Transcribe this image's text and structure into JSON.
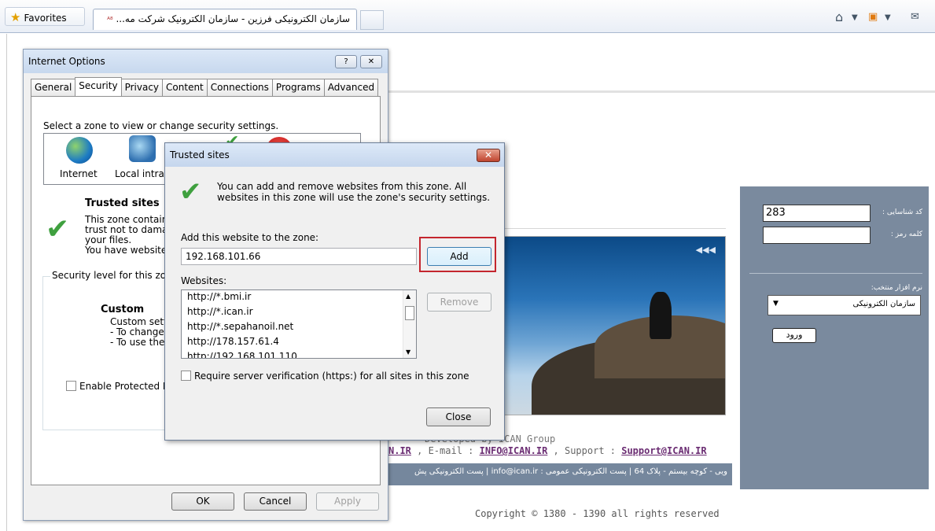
{
  "browser": {
    "favorites_label": "Favorites",
    "tab_title": "سازمان الکترونیکی فرزین - سازمان الکترونیک شرکت مه...",
    "tab_icon_text": "ᴬ⁸"
  },
  "page": {
    "right_panel": {
      "id_label": "کد شناسایی :",
      "id_value": "283",
      "password_label": "کلمه رمز :",
      "software_label": "نرم افزار منتخب:",
      "software_value": "سازمان الکترونیکی",
      "login_button": "ورود"
    },
    "footer": {
      "group_line": "Developed by ICAN Group",
      "links_prefix": "N.IR",
      "email_label": " , E-mail : ",
      "email": "INFO@ICAN.IR",
      "support_label": " , Support : ",
      "support": "Support@ICAN.IR",
      "bar_text": "ویی - کوچه بیستم - پلاک 64  |  پست الکترونیکی عمومی : info@ican.ir  |  پست الکترونیکی پش",
      "copyright": "Copyright © 1380 - 1390 all rights reserved"
    }
  },
  "internet_options": {
    "title": "Internet Options",
    "help_btn": "?",
    "close_btn": "✕",
    "tabs": [
      "General",
      "Security",
      "Privacy",
      "Content",
      "Connections",
      "Programs",
      "Advanced"
    ],
    "select_zone_text": "Select a zone to view or change security settings.",
    "zones": [
      "Internet",
      "Local intran"
    ],
    "zone_title": "Trusted sites",
    "zone_desc": [
      "This zone contains",
      "trust not to damage",
      "your files.",
      "You have websites"
    ],
    "security_level_label": "Security level for this zone",
    "custom_title": "Custom",
    "custom_lines": [
      "Custom setti",
      "- To change",
      "- To use the"
    ],
    "protected_mode": "Enable Protected Mo",
    "ok": "OK",
    "cancel": "Cancel",
    "apply": "Apply"
  },
  "trusted_sites": {
    "title": "Trusted sites",
    "close_btn": "✕",
    "info_text": "You can add and remove websites from this zone. All websites in this zone will use the zone's security settings.",
    "add_label": "Add this website to the zone:",
    "add_value": "192.168.101.66",
    "add_button": "Add",
    "websites_label": "Websites:",
    "websites": [
      "http://*.bmi.ir",
      "http://*.ican.ir",
      "http://*.sepahanoil.net",
      "http://178.157.61.4",
      "http://192.168.101.110"
    ],
    "remove_button": "Remove",
    "require_https": "Require server verification (https:) for all sites in this zone",
    "close_button": "Close"
  },
  "colors": {
    "highlight_box": "#c4262e",
    "panel": "#7a8a9e",
    "link": "#6b2d73"
  }
}
